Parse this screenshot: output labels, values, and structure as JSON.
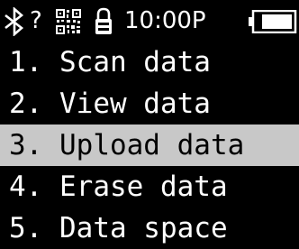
{
  "colors": {
    "background": "#000000",
    "text": "#ffffff",
    "selected_background": "#c8c8c8",
    "selected_text": "#000000"
  },
  "status_bar": {
    "icons": [
      "bluetooth-icon",
      "qr-code-icon",
      "lock-icon",
      "battery-icon"
    ],
    "unknown_indicator": "?",
    "time": "10:00P",
    "battery_level_fraction": 0.85
  },
  "menu": {
    "selected_index": 2,
    "items": [
      {
        "label": "1. Scan data"
      },
      {
        "label": "2. View data"
      },
      {
        "label": "3. Upload data"
      },
      {
        "label": "4. Erase data"
      },
      {
        "label": "5. Data space"
      }
    ]
  }
}
